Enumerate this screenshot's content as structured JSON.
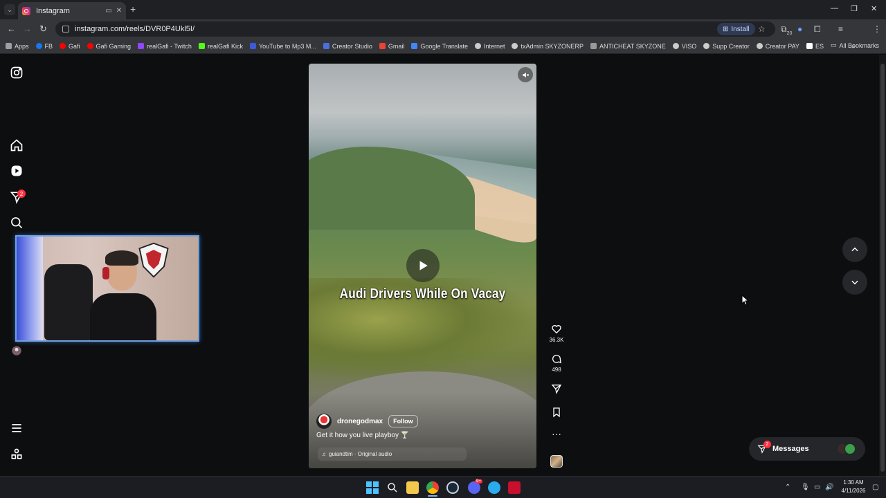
{
  "browser": {
    "tab_title": "Instagram",
    "url": "instagram.com/reels/DVR0P4Ukl5I/",
    "install_label": "Install",
    "extension_badge": "20",
    "bookmarks": [
      {
        "label": "Apps",
        "color": "#9aa0a6"
      },
      {
        "label": "FB",
        "color": "#1877f2"
      },
      {
        "label": "Gafi",
        "color": "#ff0000"
      },
      {
        "label": "Gafi Gaming",
        "color": "#ff0000"
      },
      {
        "label": "realGafi - Twitch",
        "color": "#9146ff"
      },
      {
        "label": "realGafi Kick",
        "color": "#53fc18"
      },
      {
        "label": "YouTube to Mp3 M...",
        "color": "#3b5bdb"
      },
      {
        "label": "Creator Studio",
        "color": "#4a6ee0"
      },
      {
        "label": "Gmail",
        "color": "#ea4335"
      },
      {
        "label": "Google Translate",
        "color": "#4285f4"
      },
      {
        "label": "Internet",
        "color": "#cccccc"
      },
      {
        "label": "txAdmin SKYZONERP",
        "color": "#cccccc"
      },
      {
        "label": "ANTICHEAT SKYZONE",
        "color": "#999999"
      },
      {
        "label": "VISO",
        "color": "#cccccc"
      },
      {
        "label": "Supp Creator",
        "color": "#cccccc"
      },
      {
        "label": "Creator PAY",
        "color": "#cccccc"
      },
      {
        "label": "ES",
        "color": "#ffffff"
      }
    ],
    "all_bookmarks": "All Bookmarks"
  },
  "sidebar": {
    "notification_count": "2"
  },
  "reel": {
    "caption": "Audi Drivers While On Vacay",
    "author": "dronegodmax",
    "follow_label": "Follow",
    "description": "Get it how you live playboy 🍸",
    "audio": "guiandtim · Original audio"
  },
  "actions": {
    "likes": "36.3K",
    "comments": "498"
  },
  "messages": {
    "label": "Messages",
    "badge": "2"
  },
  "taskbar": {
    "time": "1:30 AM",
    "date": "4/11/2026",
    "discord_badge": "9+"
  }
}
